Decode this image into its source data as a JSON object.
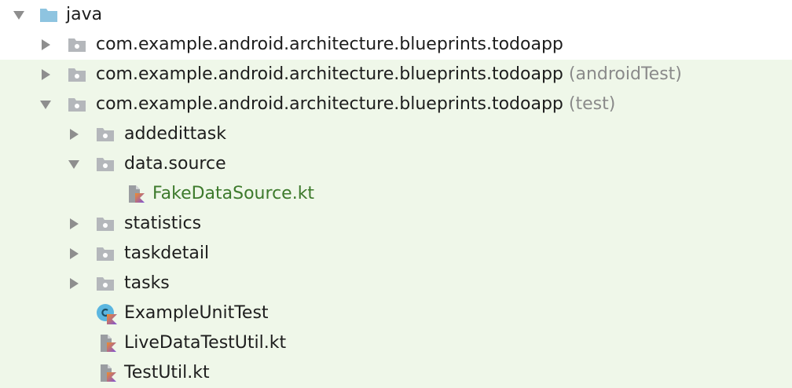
{
  "colors": {
    "test_background": "#eff7e9",
    "modified_file_text": "#3d7a2c",
    "suffix_text": "#8a8a8a",
    "folder_icon": "#b4b7bb",
    "source_root_folder_icon": "#8ec4e0",
    "arrow": "#8e8e8e",
    "kotlin_gradient_start": "#f28b2a",
    "kotlin_gradient_end": "#7b52d9",
    "class_icon": "#5bb6e0"
  },
  "tree": {
    "rows": [
      {
        "label": "java",
        "suffix": "",
        "expanded": true,
        "icon": "source-root-folder-icon"
      },
      {
        "label": "com.example.android.architecture.blueprints.todoapp",
        "suffix": "",
        "expanded": false,
        "icon": "package-folder-icon"
      },
      {
        "label": "com.example.android.architecture.blueprints.todoapp",
        "suffix": " (androidTest)",
        "expanded": false,
        "icon": "package-folder-icon"
      },
      {
        "label": "com.example.android.architecture.blueprints.todoapp",
        "suffix": " (test)",
        "expanded": true,
        "icon": "package-folder-icon"
      },
      {
        "label": "addedittask",
        "suffix": "",
        "expanded": false,
        "icon": "package-folder-icon"
      },
      {
        "label": "data.source",
        "suffix": "",
        "expanded": true,
        "icon": "package-folder-icon"
      },
      {
        "label": "FakeDataSource.kt",
        "suffix": "",
        "icon": "kotlin-file-icon"
      },
      {
        "label": "statistics",
        "suffix": "",
        "expanded": false,
        "icon": "package-folder-icon"
      },
      {
        "label": "taskdetail",
        "suffix": "",
        "expanded": false,
        "icon": "package-folder-icon"
      },
      {
        "label": "tasks",
        "suffix": "",
        "expanded": false,
        "icon": "package-folder-icon"
      },
      {
        "label": "ExampleUnitTest",
        "suffix": "",
        "icon": "kotlin-class-icon"
      },
      {
        "label": "LiveDataTestUtil.kt",
        "suffix": "",
        "icon": "kotlin-file-icon"
      },
      {
        "label": "TestUtil.kt",
        "suffix": "",
        "icon": "kotlin-file-icon"
      }
    ]
  }
}
